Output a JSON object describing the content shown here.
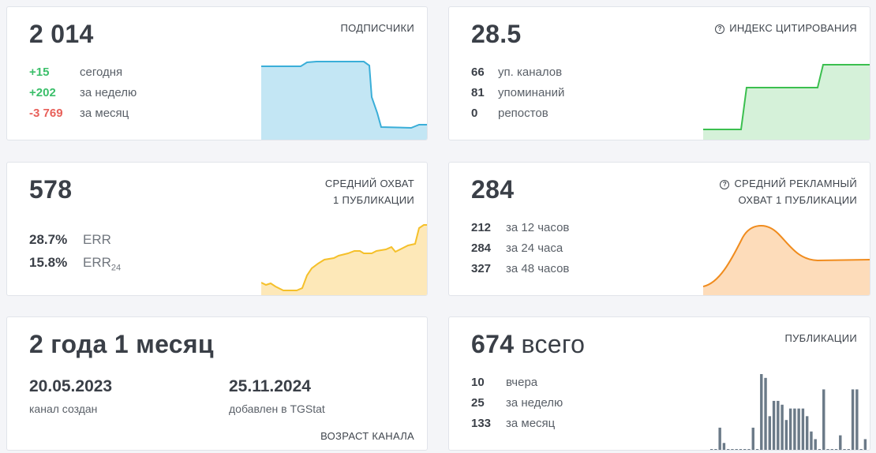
{
  "subscribers": {
    "value": "2 014",
    "title": "ПОДПИСЧИКИ",
    "rows": [
      {
        "value": "+15",
        "label": "сегодня",
        "tone": "green"
      },
      {
        "value": "+202",
        "label": "за неделю",
        "tone": "green"
      },
      {
        "value": "-3 769",
        "label": "за месяц",
        "tone": "red"
      }
    ],
    "color": "#3aaed8"
  },
  "citation": {
    "value": "28.5",
    "title": "ИНДЕКС ЦИТИРОВАНИЯ",
    "help_icon": "question-circle-icon",
    "rows": [
      {
        "value": "66",
        "label": "уп. каналов"
      },
      {
        "value": "81",
        "label": "упоминаний"
      },
      {
        "value": "0",
        "label": "репостов"
      }
    ],
    "color": "#3bbf4f"
  },
  "reach": {
    "value": "578",
    "title_line1": "СРЕДНИЙ ОХВАТ",
    "title_line2": "1 ПУБЛИКАЦИИ",
    "err": {
      "value": "28.7%",
      "label": "ERR"
    },
    "err24": {
      "value": "15.8%",
      "label": "ERR",
      "sub": "24"
    },
    "color": "#f5c02a"
  },
  "ad_reach": {
    "value": "284",
    "title_line1": "СРЕДНИЙ РЕКЛАМНЫЙ",
    "title_line2": "ОХВАТ 1 ПУБЛИКАЦИИ",
    "help_icon": "question-circle-icon",
    "rows": [
      {
        "value": "212",
        "label": "за 12 часов"
      },
      {
        "value": "284",
        "label": "за 24 часа"
      },
      {
        "value": "327",
        "label": "за 48 часов"
      }
    ],
    "color": "#f08c1e"
  },
  "age": {
    "value": "2 года 1 месяц",
    "created_date": "20.05.2023",
    "created_label": "канал создан",
    "added_date": "25.11.2024",
    "added_label": "добавлен в TGStat",
    "title": "ВОЗРАСТ КАНАЛА"
  },
  "publications": {
    "value": "674",
    "value_suffix": "всего",
    "title": "ПУБЛИКАЦИИ",
    "rows": [
      {
        "value": "10",
        "label": "вчера"
      },
      {
        "value": "25",
        "label": "за неделю"
      },
      {
        "value": "133",
        "label": "за месяц"
      }
    ],
    "bars": [
      0,
      0,
      6,
      2,
      0,
      0,
      0,
      0,
      0,
      0,
      6,
      0,
      20,
      19,
      9,
      13,
      13,
      12,
      8,
      11,
      11,
      11,
      11,
      9,
      5,
      3,
      0,
      16,
      0,
      0,
      0,
      4,
      0,
      0,
      16,
      16,
      0,
      3
    ],
    "bar_color": "#6b7a88"
  }
}
